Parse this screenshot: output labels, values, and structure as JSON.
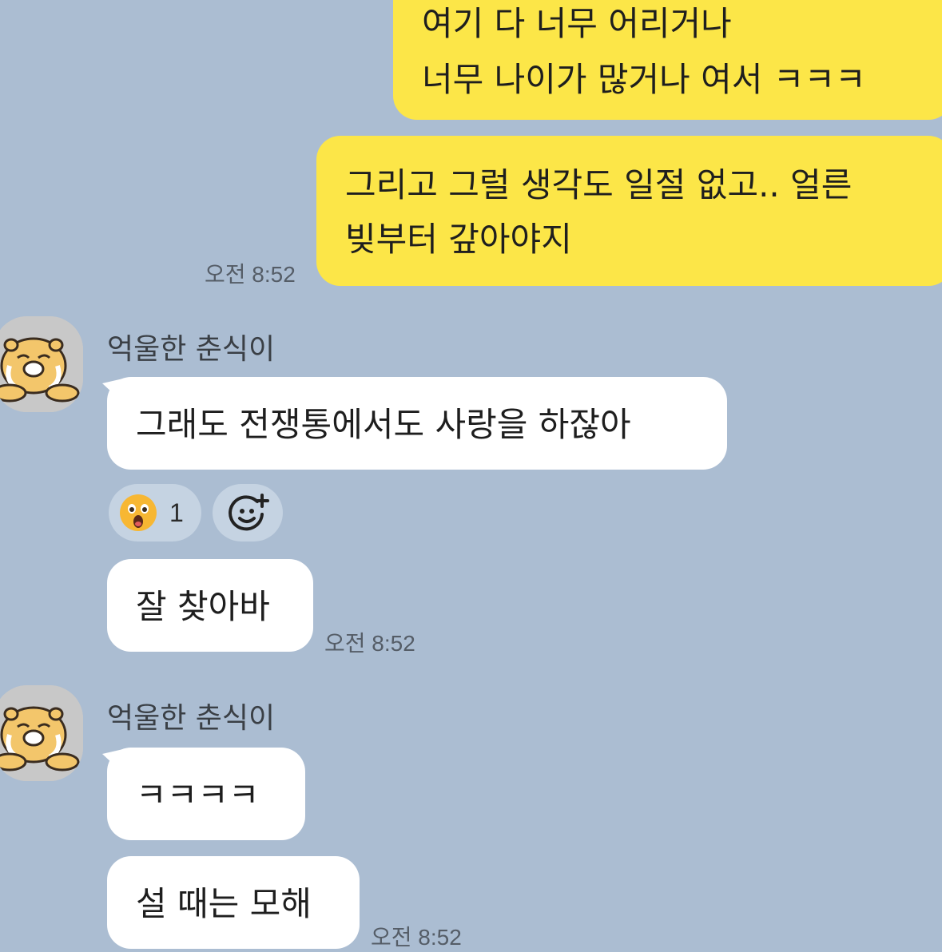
{
  "messages": {
    "m1": {
      "line1": "여기 다 너무 어리거나",
      "line2": "너무 나이가 많거나 여서 ㅋㅋㅋ"
    },
    "m2": {
      "line1": "그리고 그럴 생각도 일절 없고.. 얼른",
      "line2": "빚부터 갚아야지",
      "time": "오전 8:52"
    },
    "g1": {
      "sender": "억울한 춘식이",
      "b1": "그래도 전쟁통에서도 사랑을 하잖아",
      "reaction_count": "1",
      "b2": "잘 찾아바",
      "time": "오전 8:52"
    },
    "g2": {
      "sender": "억울한 춘식이",
      "b1": "ㅋㅋㅋㅋ",
      "b2": "설 때는 모해",
      "time": "오전 8:52"
    }
  },
  "colors": {
    "background": "#abbdd2",
    "my_bubble": "#fce648",
    "their_bubble": "#ffffff"
  },
  "icons": {
    "avatar": "chunsik-crying-avatar",
    "reaction": "surprised-face-emoji",
    "add_reaction": "add-reaction-smiley-icon"
  }
}
